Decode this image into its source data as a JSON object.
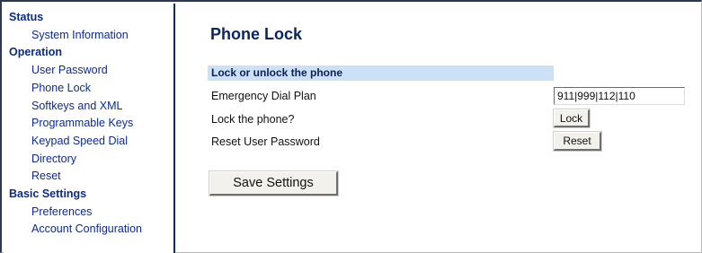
{
  "sidebar": {
    "sections": [
      {
        "label": "Status",
        "items": [
          "System Information"
        ]
      },
      {
        "label": "Operation",
        "items": [
          "User Password",
          "Phone Lock",
          "Softkeys and XML",
          "Programmable Keys",
          "Keypad Speed Dial",
          "Directory",
          "Reset"
        ]
      },
      {
        "label": "Basic Settings",
        "items": [
          "Preferences",
          "Account Configuration"
        ]
      }
    ]
  },
  "main": {
    "title": "Phone Lock",
    "section_header": "Lock or unlock the phone",
    "rows": {
      "emergency": {
        "label": "Emergency Dial Plan",
        "value": "911|999|112|110"
      },
      "lock": {
        "label": "Lock the phone?",
        "button": "Lock"
      },
      "reset": {
        "label": "Reset User Password",
        "button": "Reset"
      }
    },
    "save_label": "Save Settings"
  },
  "colors": {
    "nav_text": "#0c2a96",
    "title": "#0a2566",
    "section_header_bg": "#cce1f5",
    "divider": "#0c2f63"
  }
}
